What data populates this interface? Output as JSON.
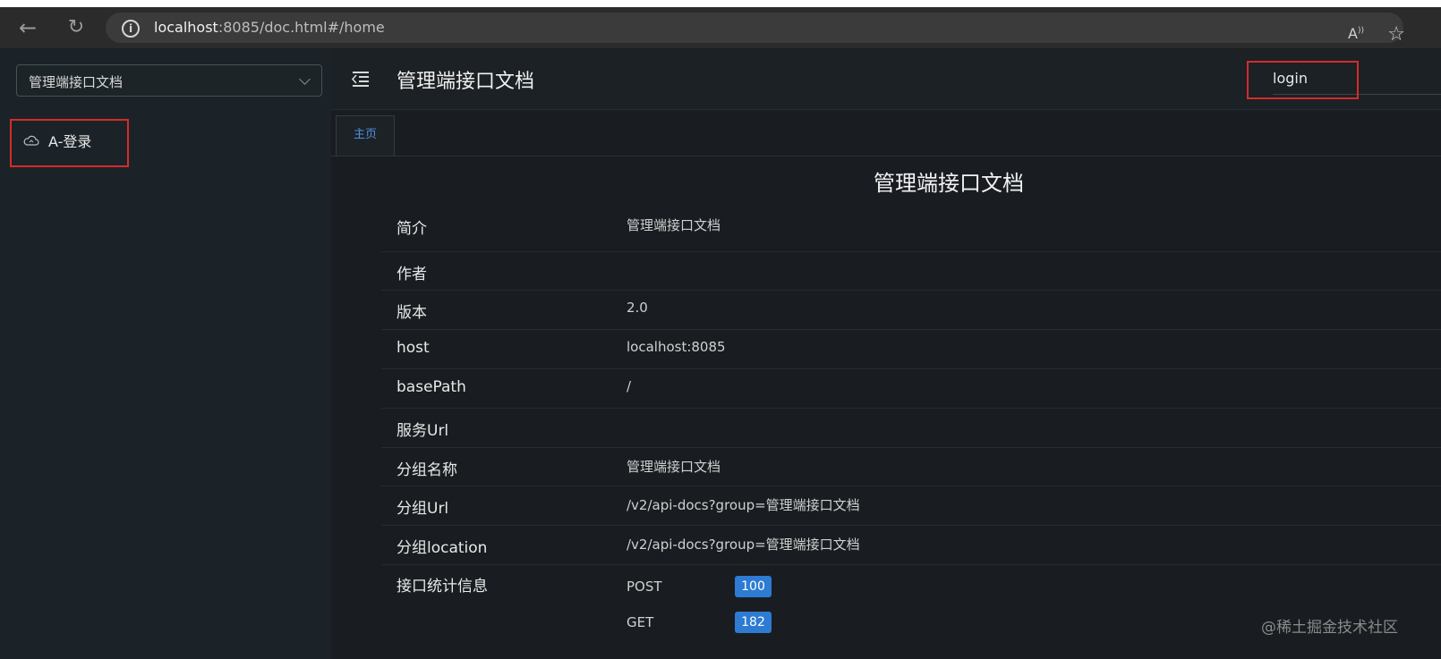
{
  "browser": {
    "url_host": "localhost",
    "url_rest": ":8085/doc.html#/home"
  },
  "sidebar": {
    "group_select_value": "管理端接口文档",
    "items": [
      {
        "label": "A-登录"
      }
    ]
  },
  "header": {
    "title": "管理端接口文档",
    "search_value": "login"
  },
  "tabs": [
    {
      "label": "主页"
    }
  ],
  "doc": {
    "title": "管理端接口文档",
    "rows": [
      {
        "label": "简介",
        "value": "管理端接口文档"
      },
      {
        "label": "作者",
        "value": ""
      },
      {
        "label": "版本",
        "value": "2.0"
      },
      {
        "label": "host",
        "value": "localhost:8085"
      },
      {
        "label": "basePath",
        "value": "/"
      },
      {
        "label": "服务Url",
        "value": ""
      },
      {
        "label": "分组名称",
        "value": "管理端接口文档"
      },
      {
        "label": "分组Url",
        "value": "/v2/api-docs?group=管理端接口文档"
      },
      {
        "label": "分组location",
        "value": "/v2/api-docs?group=管理端接口文档"
      }
    ],
    "stats": {
      "label": "接口统计信息",
      "methods": [
        {
          "method": "POST",
          "count": "100"
        },
        {
          "method": "GET",
          "count": "182"
        }
      ]
    }
  },
  "watermark": "@稀土掘金技术社区",
  "colors": {
    "highlight": "#d62b2b",
    "badge": "#2d7bd2",
    "tab_active": "#4f8fe0"
  }
}
